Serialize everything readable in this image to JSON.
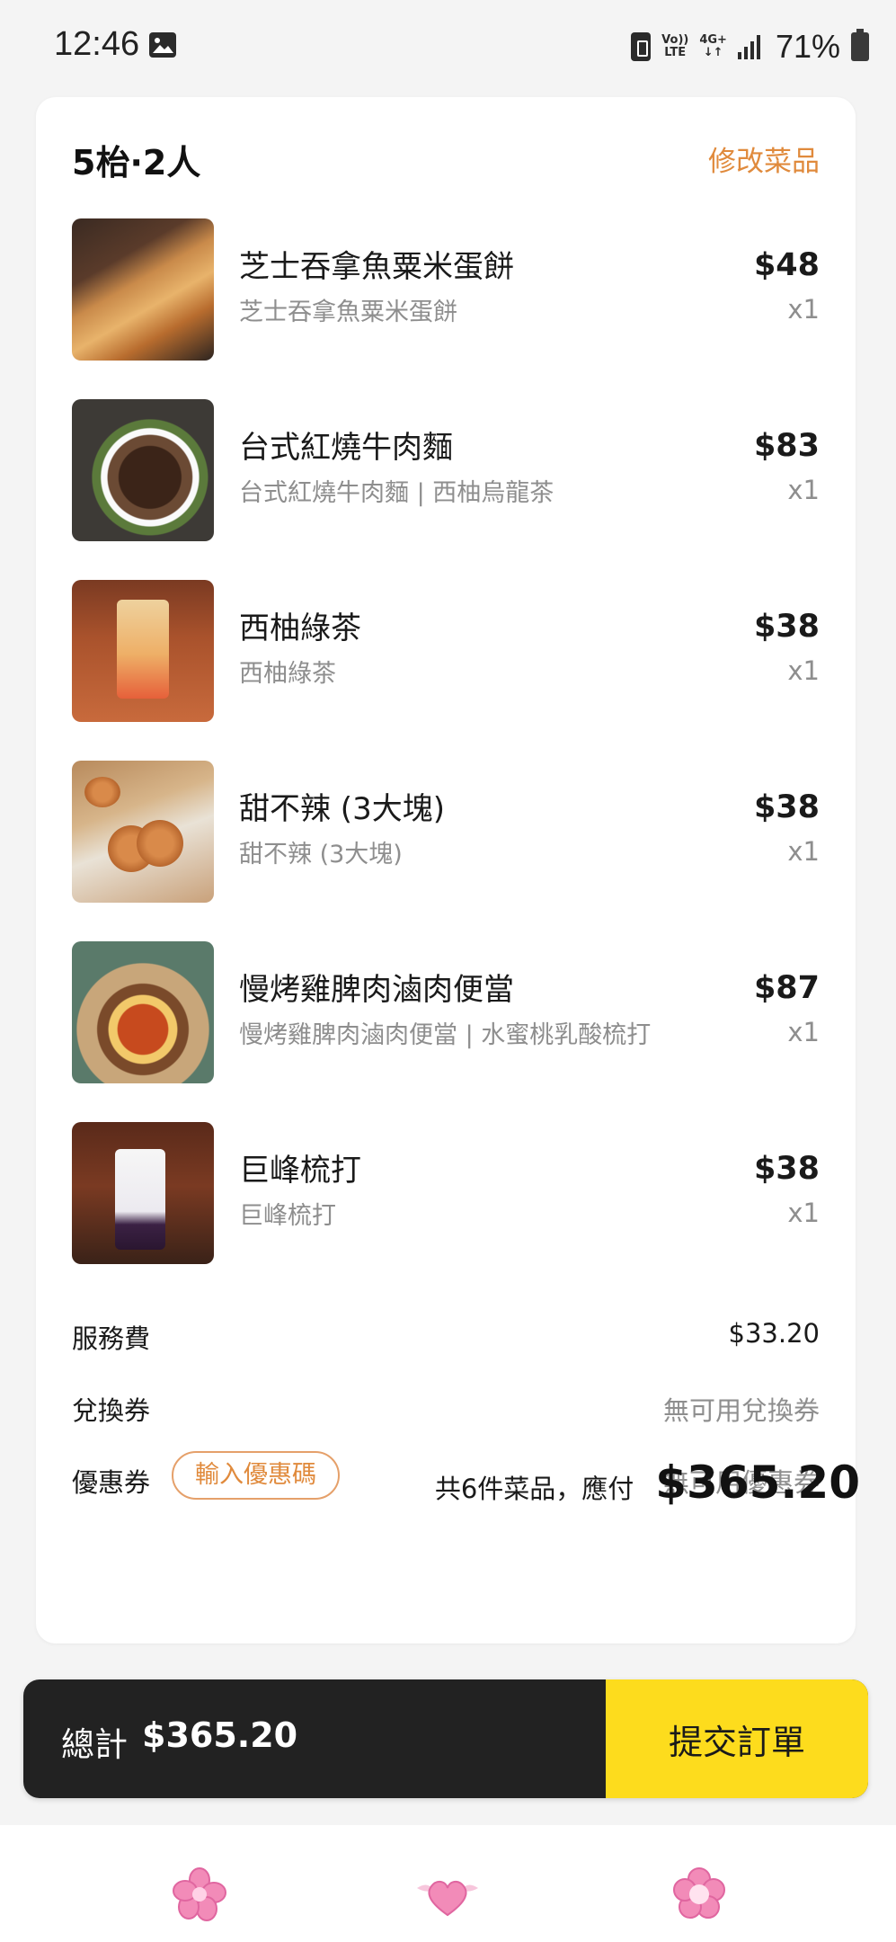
{
  "status_bar": {
    "time": "12:46",
    "volte_line1": "Vo))",
    "volte_line2": "LTE",
    "network_line1": "4G+",
    "network_line2": "↓↑",
    "battery": "71%"
  },
  "order": {
    "table_info": "5枱·2人",
    "edit_label": "修改菜品",
    "items": [
      {
        "name": "芝士吞拿魚粟米蛋餅",
        "desc": "芝士吞拿魚粟米蛋餅",
        "price": "$48",
        "qty": "x1"
      },
      {
        "name": "台式紅燒牛肉麵",
        "desc": "台式紅燒牛肉麵 | 西柚烏龍茶",
        "price": "$83",
        "qty": "x1"
      },
      {
        "name": "西柚綠茶",
        "desc": "西柚綠茶",
        "price": "$38",
        "qty": "x1"
      },
      {
        "name": "甜不辣 (3大塊)",
        "desc": "甜不辣 (3大塊)",
        "price": "$38",
        "qty": "x1"
      },
      {
        "name": "慢烤雞脾肉滷肉便當",
        "desc": "慢烤雞脾肉滷肉便當 | 水蜜桃乳酸梳打",
        "price": "$87",
        "qty": "x1"
      },
      {
        "name": "巨峰梳打",
        "desc": "巨峰梳打",
        "price": "$38",
        "qty": "x1"
      }
    ],
    "service_fee": {
      "label": "服務費",
      "value": "$33.20"
    },
    "voucher": {
      "label": "兌換券",
      "value": "無可用兌換券"
    },
    "coupon": {
      "label": "優惠券",
      "button": "輸入優惠碼",
      "value": "無可用優惠券"
    },
    "summary": {
      "label": "共6件菜品，應付",
      "total": "$365.20"
    }
  },
  "checkout": {
    "total_label": "總計",
    "total_value": "$365.20",
    "submit_label": "提交訂單"
  },
  "bottom_nav": {
    "icons": [
      "pink-flower-icon",
      "pink-winged-heart-icon",
      "pink-blossom-icon"
    ]
  },
  "colors": {
    "accent_orange": "#e08a3c",
    "submit_yellow": "#fddc1d",
    "bar_dark": "#222222",
    "nav_pink": "#f28bb8"
  }
}
